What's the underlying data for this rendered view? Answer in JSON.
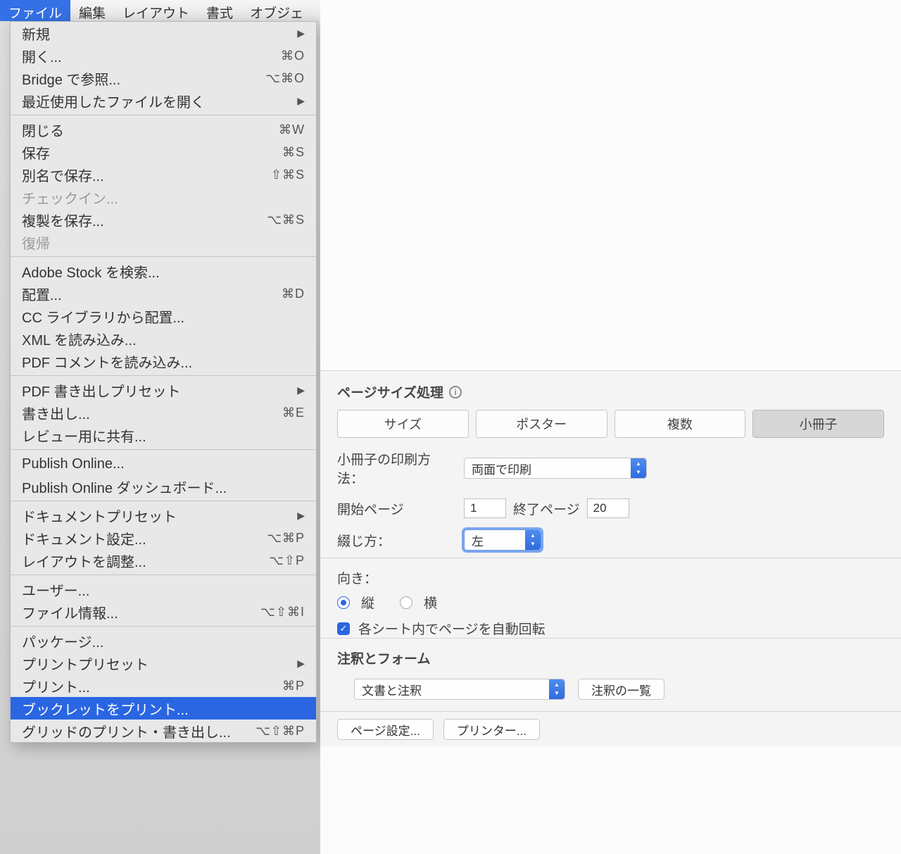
{
  "menubar": {
    "tabs": [
      "ファイル",
      "編集",
      "レイアウト",
      "書式",
      "オブジェ"
    ]
  },
  "menu": [
    {
      "label": "新規",
      "sub": true
    },
    {
      "label": "開く...",
      "shortcut": "⌘O"
    },
    {
      "label": "Bridge で参照...",
      "shortcut": "⌥⌘O"
    },
    {
      "label": "最近使用したファイルを開く",
      "sub": true
    },
    {
      "sep": true
    },
    {
      "label": "閉じる",
      "shortcut": "⌘W"
    },
    {
      "label": "保存",
      "shortcut": "⌘S"
    },
    {
      "label": "別名で保存...",
      "shortcut": "⇧⌘S"
    },
    {
      "label": "チェックイン...",
      "disabled": true
    },
    {
      "label": "複製を保存...",
      "shortcut": "⌥⌘S"
    },
    {
      "label": "復帰",
      "disabled": true
    },
    {
      "sep": true
    },
    {
      "label": "Adobe Stock を検索..."
    },
    {
      "label": "配置...",
      "shortcut": "⌘D"
    },
    {
      "label": "CC ライブラリから配置..."
    },
    {
      "label": "XML を読み込み..."
    },
    {
      "label": "PDF コメントを読み込み..."
    },
    {
      "sep": true
    },
    {
      "label": "PDF 書き出しプリセット",
      "sub": true
    },
    {
      "label": "書き出し...",
      "shortcut": "⌘E"
    },
    {
      "label": "レビュー用に共有..."
    },
    {
      "sep": true
    },
    {
      "label": "Publish Online..."
    },
    {
      "label": "Publish Online ダッシュボード..."
    },
    {
      "sep": true
    },
    {
      "label": "ドキュメントプリセット",
      "sub": true
    },
    {
      "label": "ドキュメント設定...",
      "shortcut": "⌥⌘P"
    },
    {
      "label": "レイアウトを調整...",
      "shortcut": "⌥⇧P"
    },
    {
      "sep": true
    },
    {
      "label": "ユーザー..."
    },
    {
      "label": "ファイル情報...",
      "shortcut": "⌥⇧⌘I"
    },
    {
      "sep": true
    },
    {
      "label": "パッケージ..."
    },
    {
      "label": "プリントプリセット",
      "sub": true
    },
    {
      "label": "プリント...",
      "shortcut": "⌘P"
    },
    {
      "label": "ブックレットをプリント...",
      "highlight": true
    },
    {
      "label": "グリッドのプリント・書き出し...",
      "shortcut": "⌥⇧⌘P"
    }
  ],
  "panel": {
    "pageSizeTitle": "ページサイズ処理",
    "seg": {
      "size": "サイズ",
      "poster": "ポスター",
      "multiple": "複数",
      "booklet": "小冊子"
    },
    "bookletMethodLabel": "小冊子の印刷方法：",
    "bookletMethodValue": "両面で印刷",
    "startPageLabel": "開始ページ",
    "startPageValue": "1",
    "endPageLabel": "終了ページ",
    "endPageValue": "20",
    "bindingLabel": "綴じ方：",
    "bindingValue": "左",
    "orientLabel": "向き：",
    "orientPortrait": "縦",
    "orientLandscape": "横",
    "autoRotateLabel": "各シート内でページを自動回転",
    "annotTitle": "注釈とフォーム",
    "annotSelect": "文書と注釈",
    "annotListBtn": "注釈の一覧",
    "pageSetupBtn": "ページ設定...",
    "printerBtn": "プリンター..."
  }
}
